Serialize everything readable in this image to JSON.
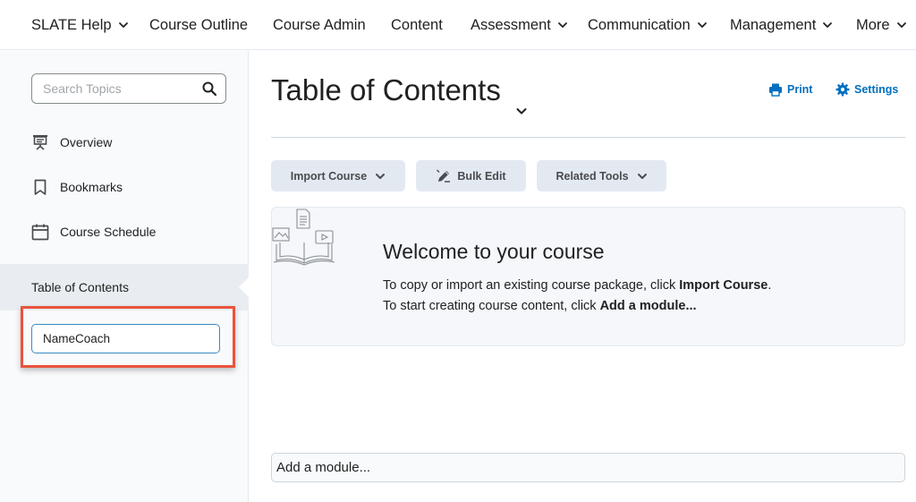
{
  "nav": {
    "items": [
      {
        "label": "SLATE Help",
        "has_menu": true
      },
      {
        "label": "Course Outline",
        "has_menu": false
      },
      {
        "label": "Course Admin",
        "has_menu": false
      },
      {
        "label": "Content",
        "has_menu": false
      },
      {
        "label": "Assessment",
        "has_menu": true
      },
      {
        "label": "Communication",
        "has_menu": true
      },
      {
        "label": "Management",
        "has_menu": true
      },
      {
        "label": "More",
        "has_menu": true
      }
    ]
  },
  "sidebar": {
    "search": {
      "placeholder": "Search Topics",
      "icon": "search-icon"
    },
    "links": [
      {
        "label": "Overview",
        "icon": "presentation-icon"
      },
      {
        "label": "Bookmarks",
        "icon": "bookmark-icon"
      },
      {
        "label": "Course Schedule",
        "icon": "calendar-icon"
      }
    ],
    "toc_label": "Table of Contents",
    "module_input_value": "NameCoach"
  },
  "main": {
    "title": "Table of Contents",
    "print_label": "Print",
    "settings_label": "Settings",
    "buttons": {
      "import_course": "Import Course",
      "bulk_edit": "Bulk Edit",
      "related_tools": "Related Tools"
    },
    "welcome": {
      "title": "Welcome to your course",
      "line1_prefix": "To copy or import an existing course package, click ",
      "line1_bold": "Import Course",
      "line1_suffix": ".",
      "line2_prefix": "To start creating course content, click ",
      "line2_bold": "Add a module..."
    },
    "add_module_placeholder": "Add a module..."
  },
  "colors": {
    "link_blue": "#006fbf",
    "highlight_red": "#e9533d",
    "button_bg": "#e3e9f1",
    "sidebar_bg": "#f9fafb"
  }
}
